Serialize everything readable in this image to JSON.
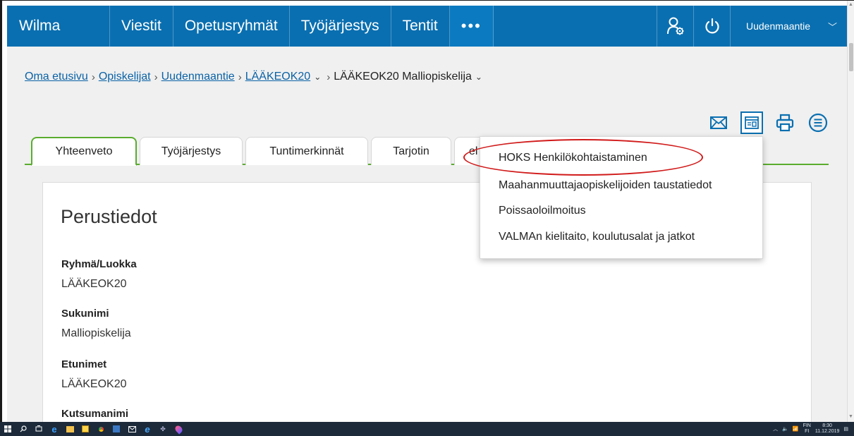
{
  "nav": {
    "brand": "Wilma",
    "items": [
      "Viestit",
      "Opetusryhmät",
      "Työjärjestys",
      "Tentit"
    ],
    "more": "•••",
    "user": "Uudenmaantie",
    "user_chevron": "﹀",
    "accent": "#0a6fb0"
  },
  "breadcrumb": {
    "links": [
      "Oma etusivu",
      "Opiskelijat",
      "Uudenmaantie",
      "LÄÄKEOK20"
    ],
    "current": "LÄÄKEOK20 Malliopiskelija",
    "separator": "›",
    "dropdown": "⌄"
  },
  "toolbar": {
    "icons": [
      "mail-icon",
      "form-icon",
      "print-icon",
      "menu-icon"
    ]
  },
  "tabs": [
    "Yhteenveto",
    "Työjärjestys",
    "Tuntimerkinnät",
    "Tarjotin",
    "el"
  ],
  "tab_accent": "#5aac2e",
  "section": {
    "title": "Perustiedot",
    "fields": [
      {
        "label": "Ryhmä/Luokka",
        "value": "LÄÄKEOK20"
      },
      {
        "label": "Sukunimi",
        "value": "Malliopiskelija"
      },
      {
        "label": "Etunimet",
        "value": "LÄÄKEOK20"
      },
      {
        "label": "Kutsumanimi",
        "value": ""
      }
    ]
  },
  "menu": {
    "items": [
      "HOKS Henkilökohtaistaminen",
      "Maahanmuuttajaopiskelijoiden taustatiedot",
      "Poissaoloilmoitus",
      "VALMAn kielitaito, koulutusalat ja jatkot"
    ],
    "highlight_color": "#d11a1a"
  },
  "taskbar": {
    "lang": "FIN",
    "sublang": "FI",
    "time": "8:30",
    "date": "11.12.2019"
  }
}
